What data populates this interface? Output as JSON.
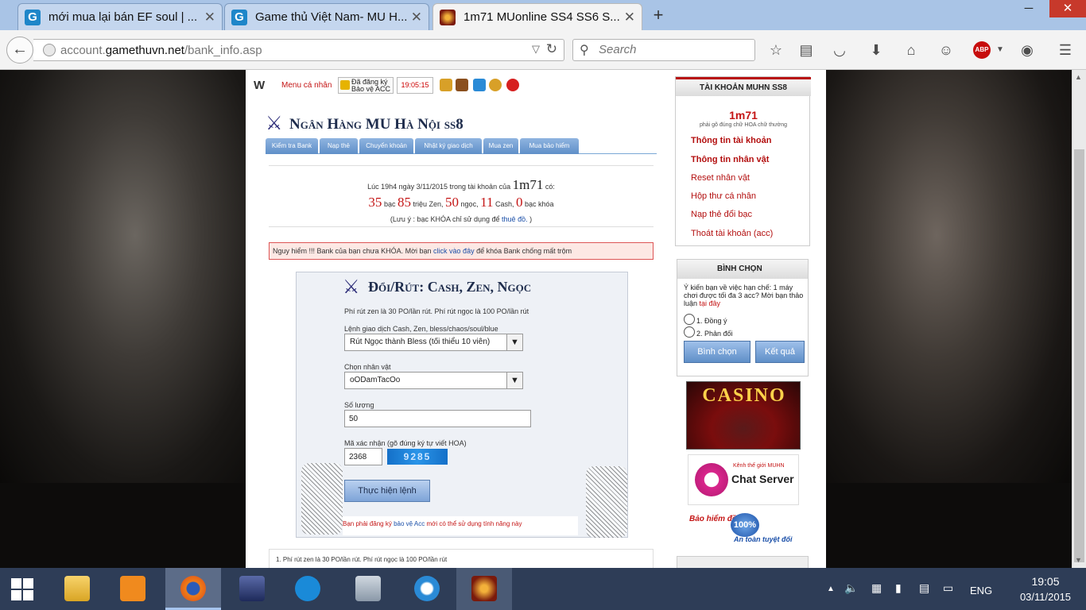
{
  "tabs": [
    {
      "title": "mới mua lại bán EF soul | ...",
      "favicon": "G"
    },
    {
      "title": "Game thủ Việt Nam- MU H...",
      "favicon": "G"
    },
    {
      "title": "1m71 MUonline SS4 SS6 S...",
      "favicon": "mu"
    }
  ],
  "address": {
    "host_prefix": "account.",
    "host": "gamethuvn.net",
    "path": "/bank_info.asp"
  },
  "search": {
    "placeholder": "Search"
  },
  "topbar": {
    "logo": "W",
    "menu": "Menu cá nhân",
    "reg_line1": "Đã đăng ký",
    "reg_line2": "Bảo vệ ACC",
    "clock": "19:05:15"
  },
  "bank": {
    "title": "Ngân Hàng MU Hà Nội ss8",
    "tabs": [
      "Kiểm tra Bank",
      "Nạp thẻ",
      "Chuyển khoản",
      "Nhật ký giao dịch",
      "Mua zen",
      "Mua bảo hiểm"
    ],
    "info_prefix": "Lúc 19h4 ngày 3/11/2015 trong tài khoản của",
    "account": "1m71",
    "info_suffix": "có:",
    "bac": "35",
    "bac_lbl": "bạc",
    "zen": "85",
    "zen_lbl": "triệu Zen,",
    "ngoc": "50",
    "ngoc_lbl": "ngọc,",
    "cash": "11",
    "cash_lbl": "Cash,",
    "bac_khoa": "0",
    "bac_khoa_lbl": "bạc khóa",
    "note_prefix": "(Lưu ý : bạc KHÓA chỉ sử dụng để",
    "note_link": "thuê đồ.",
    "note_suffix": ")",
    "warn_prefix": "Nguy hiểm !!! Bank của bạn chưa KHÓA. Mời bạn",
    "warn_link": "click vào đây",
    "warn_suffix": "để khóa Bank chống mất trộm"
  },
  "form": {
    "title": "Đổi/Rút: Cash, Zen, Ngọc",
    "fee_note": "Phí rút zen là 30 PO/lần rút. Phí rút ngọc là 100 PO/lần rút",
    "cmd_label": "Lệnh giao dịch Cash, Zen, bless/chaos/soul/blue",
    "cmd_value": "Rút Ngọc thành Bless (tối thiểu 10 viên)",
    "char_label": "Chọn nhân vật",
    "char_value": "oODamTacOo",
    "qty_label": "Số lượng",
    "qty_value": "50",
    "captcha_label": "Mã xác nhận (gõ đúng ký tự viết HOA)",
    "captcha_value": "2368",
    "captcha_image": "9285",
    "submit": "Thực hiện lệnh",
    "foot_prefix": "Bạn phải đăng ký",
    "foot_link": "bảo vệ Acc",
    "foot_suffix": "mới có thể sử dụng tính năng này"
  },
  "notes": {
    "line1": "1. Phí rút zen là 30 PO/lần rút. Phí rút ngọc là 100 PO/lần rút"
  },
  "sidebar": {
    "title": "TÀI KHOẢN MUHN SS8",
    "username": "1m71",
    "hint": "phải gõ đúng chữ HOA chữ thường",
    "links": [
      "Thông tin tài khoản",
      "Thông tin nhân vật",
      "Reset nhân vật",
      "Hộp thư cá nhân",
      "Nạp thẻ đổi bạc",
      "Thoát tài khoản (acc)"
    ]
  },
  "poll": {
    "title": "BÌNH CHỌN",
    "question": "Ý kiến bạn về việc hạn chế: 1 máy chơi được tối đa 3 acc? Mời bạn thảo luận",
    "question_link": "tại đây",
    "opt1": "1. Đồng ý",
    "opt2": "2. Phản đối",
    "vote": "Bình chọn",
    "result": "Kết quả"
  },
  "banners": {
    "casino": "CASINO",
    "chat_kenh": "Kênh thế giới MUHN",
    "chat": "Chat Server",
    "insure": "Bảo hiểm đồ",
    "insure_pct": "100%",
    "insure_safe": "An toàn tuyệt đối"
  },
  "taskbar": {
    "lang": "ENG",
    "time": "19:05",
    "date": "03/11/2015"
  }
}
